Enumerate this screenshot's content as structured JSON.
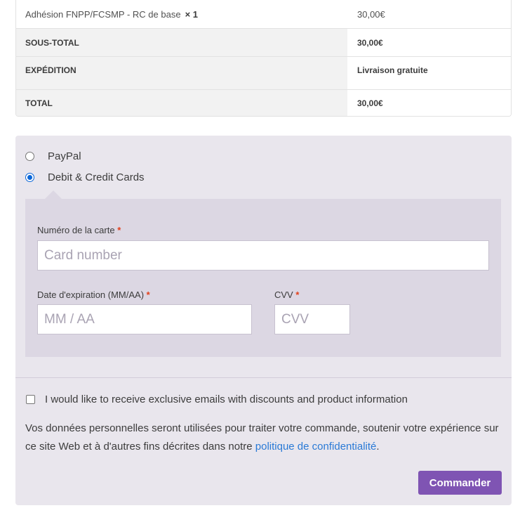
{
  "order": {
    "item": {
      "name": "Adhésion FNPP/FCSMP - RC de base",
      "qty": "× 1",
      "price": "30,00€"
    },
    "subtotal": {
      "label": "SOUS-TOTAL",
      "value": "30,00€"
    },
    "shipping": {
      "label": "EXPÉDITION",
      "value": "Livraison gratuite"
    },
    "total": {
      "label": "TOTAL",
      "value": "30,00€"
    }
  },
  "payment": {
    "methods": [
      {
        "label": "PayPal",
        "selected": false
      },
      {
        "label": "Debit & Credit Cards",
        "selected": true
      }
    ],
    "card": {
      "number_label": "Numéro de la carte",
      "number_placeholder": "Card number",
      "expiry_label": "Date d'expiration (MM/AA)",
      "expiry_placeholder": "MM / AA",
      "cvv_label": "CVV",
      "cvv_placeholder": "CVV",
      "required_mark": "*"
    },
    "optin_label": "I would like to receive exclusive emails with discounts and product information",
    "privacy_text": "Vos données personnelles seront utilisées pour traiter votre commande, soutenir votre expérience sur ce site Web et à d'autres fins décrites dans notre ",
    "privacy_link": "politique de confidentialité",
    "privacy_end": ".",
    "submit_label": "Commander"
  },
  "colors": {
    "accent": "#7f54b3",
    "link": "#2a7ad6",
    "required": "#e2401c"
  }
}
